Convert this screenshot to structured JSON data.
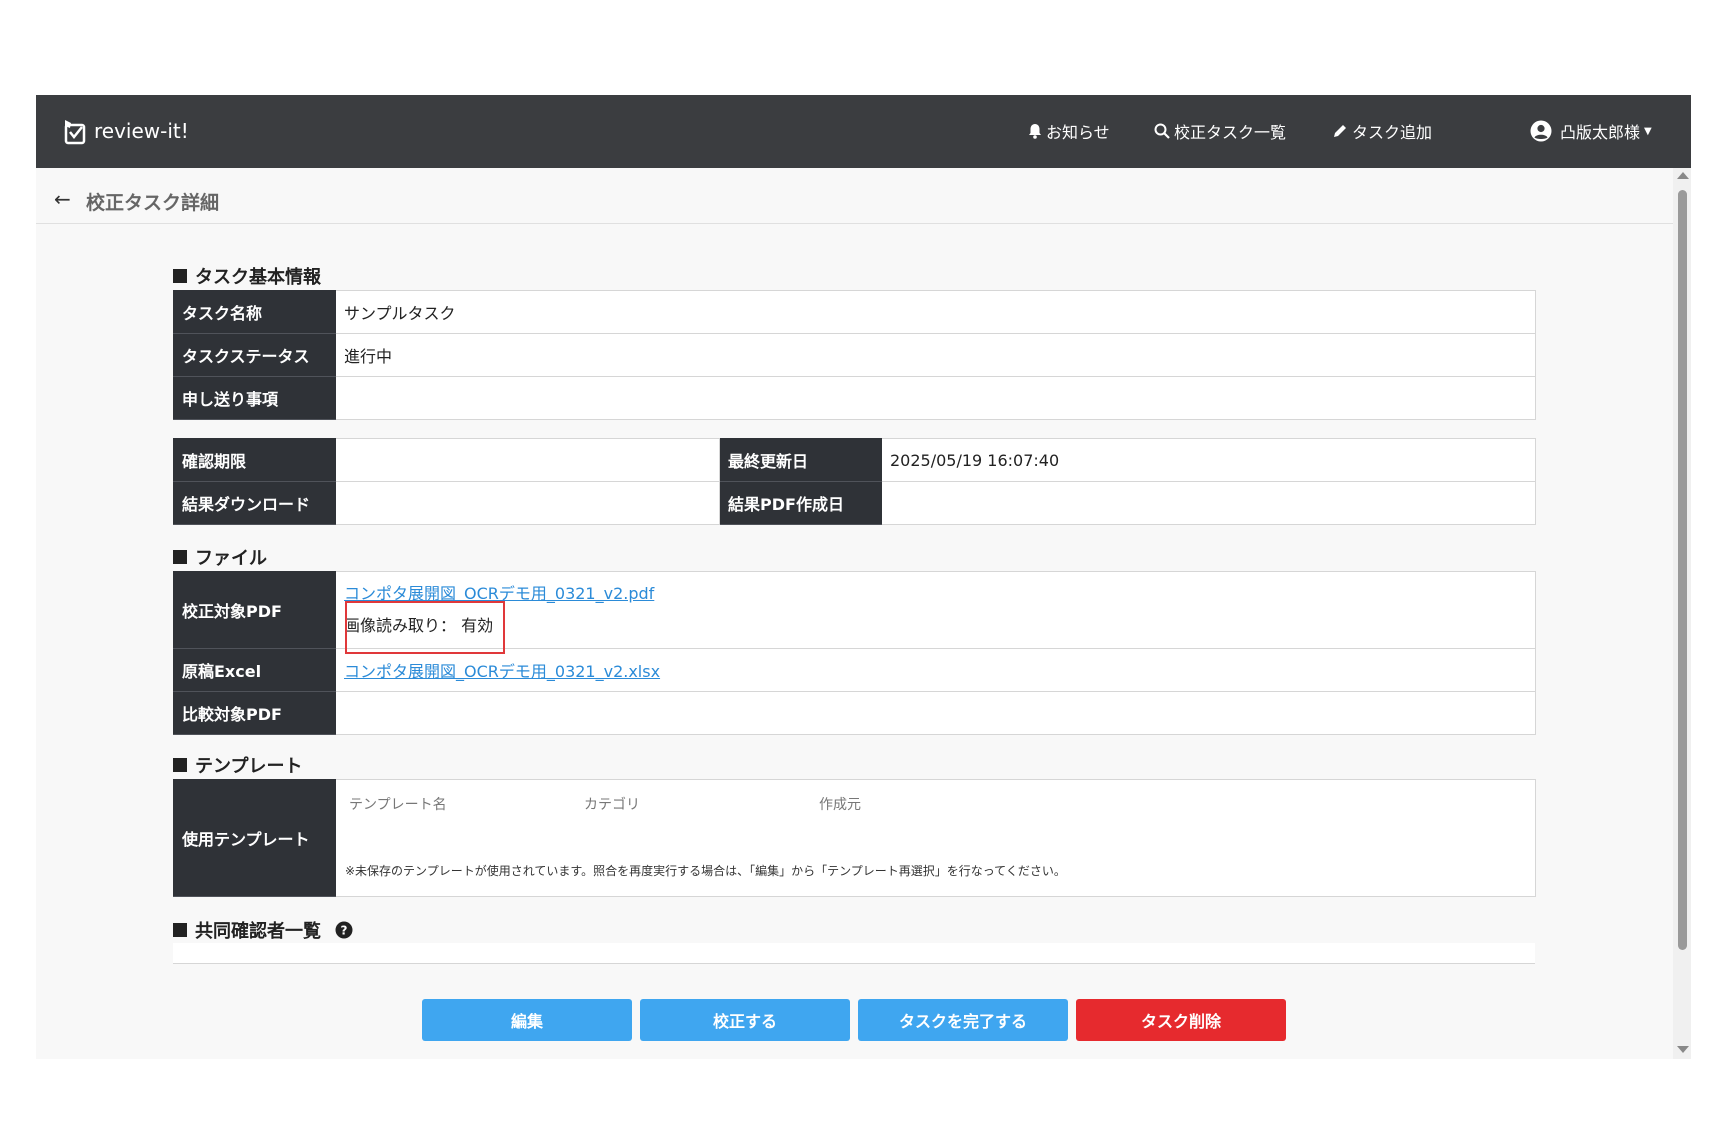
{
  "app": {
    "name": "review-it!"
  },
  "nav": {
    "notifications": "お知らせ",
    "task_list": "校正タスク一覧",
    "add_task": "タスク追加",
    "user": "凸版太郎様"
  },
  "page": {
    "title": "校正タスク詳細"
  },
  "basic_info": {
    "heading": "タスク基本情報",
    "rows": [
      {
        "label": "タスク名称",
        "value": "サンプルタスク"
      },
      {
        "label": "タスクステータス",
        "value": "進行中"
      },
      {
        "label": "申し送り事項",
        "value": ""
      }
    ]
  },
  "dates": {
    "deadline_label": "確認期限",
    "deadline_value": "",
    "updated_label": "最終更新日",
    "updated_value": "2025/05/19 16:07:40",
    "download_label": "結果ダウンロード",
    "download_value": "",
    "pdf_created_label": "結果PDF作成日",
    "pdf_created_value": ""
  },
  "files": {
    "heading": "ファイル",
    "target_pdf_label": "校正対象PDF",
    "target_pdf_file": "コンポタ展開図_OCRデモ用_0321_v2.pdf",
    "ocr_label": "画像読み取り：",
    "ocr_value": "有効",
    "excel_label": "原稿Excel",
    "excel_file": "コンポタ展開図_OCRデモ用_0321_v2.xlsx",
    "compare_pdf_label": "比較対象PDF",
    "compare_pdf_file": ""
  },
  "template": {
    "heading": "テンプレート",
    "label": "使用テンプレート",
    "col_name": "テンプレート名",
    "col_category": "カテゴリ",
    "col_creator": "作成元",
    "note": "※未保存のテンプレートが使用されています。照合を再度実行する場合は、「編集」から「テンプレート再選択」を行なってください。"
  },
  "reviewers": {
    "heading": "共同確認者一覧"
  },
  "buttons": {
    "edit": "編集",
    "proofread": "校正する",
    "complete": "タスクを完了する",
    "delete": "タスク削除"
  },
  "colors": {
    "navbar": "#3b3d40",
    "header_cell": "#2f3237",
    "primary_button": "#3fa6f0",
    "danger_button": "#e62a2e",
    "link": "#2b8bd8",
    "highlight_border": "#e0383a"
  }
}
